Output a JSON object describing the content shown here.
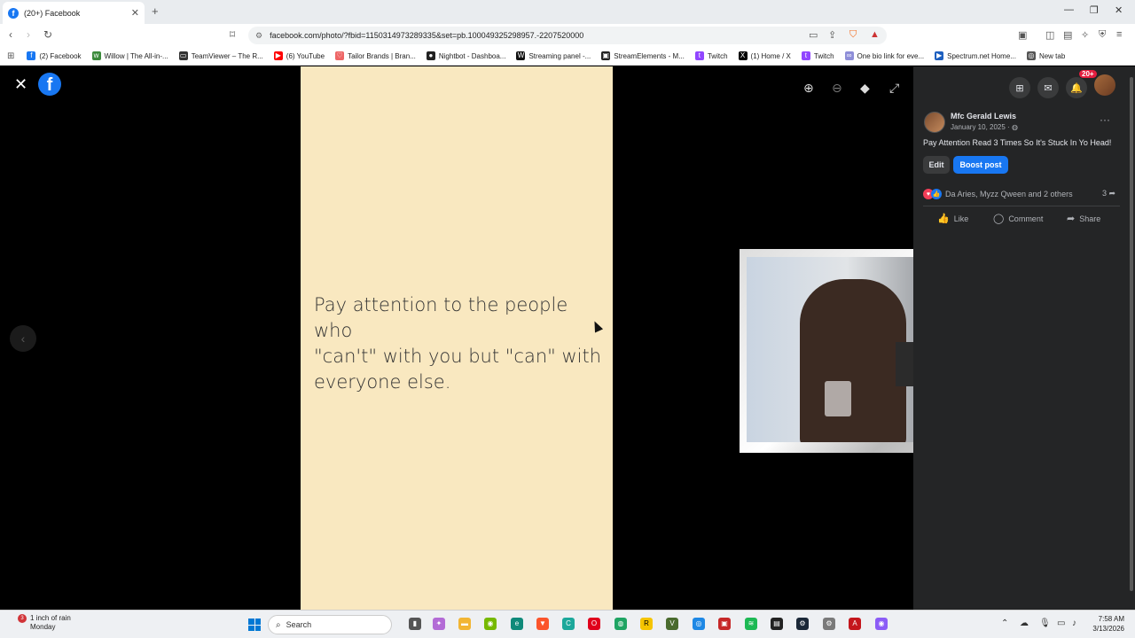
{
  "browser": {
    "tab_title": "(20+) Facebook",
    "url": "facebook.com/photo/?fbid=1150314973289335&set=pb.100049325298957.-2207520000",
    "bookmarks": [
      "(2) Facebook",
      "Willow | The All-in-...",
      "TeamViewer – The R...",
      "(6) YouTube",
      "Tailor Brands | Bran...",
      "Nightbot - Dashboa...",
      "Streaming panel -...",
      "StreamElements - M...",
      "Twitch",
      "(1) Home / X",
      "Twitch",
      "One bio link for eve...",
      "Spectrum.net Home...",
      "New tab"
    ]
  },
  "viewer": {
    "quote_line1": "Pay attention to the people who",
    "quote_line2": "\"can't\" with you but \"can\" with",
    "quote_line3": "everyone else."
  },
  "post": {
    "notifications_badge": "20+",
    "author": "Mfc Gerald Lewis",
    "date": "January 10, 2025 ·",
    "caption": "Pay Attention Read 3 Times So It's Stuck In Yo Head!",
    "edit_label": "Edit",
    "boost_label": "Boost post",
    "reactions_text": "Da Aries, Myzz Qween and 2 others",
    "shares_count": "3",
    "like_label": "Like",
    "comment_label": "Comment",
    "share_label": "Share"
  },
  "taskbar": {
    "weather_line1": "1 inch of rain",
    "weather_line2": "Monday",
    "weather_badge": "3",
    "search_label": "Search",
    "time": "7:58 AM",
    "date": "3/13/2026"
  }
}
